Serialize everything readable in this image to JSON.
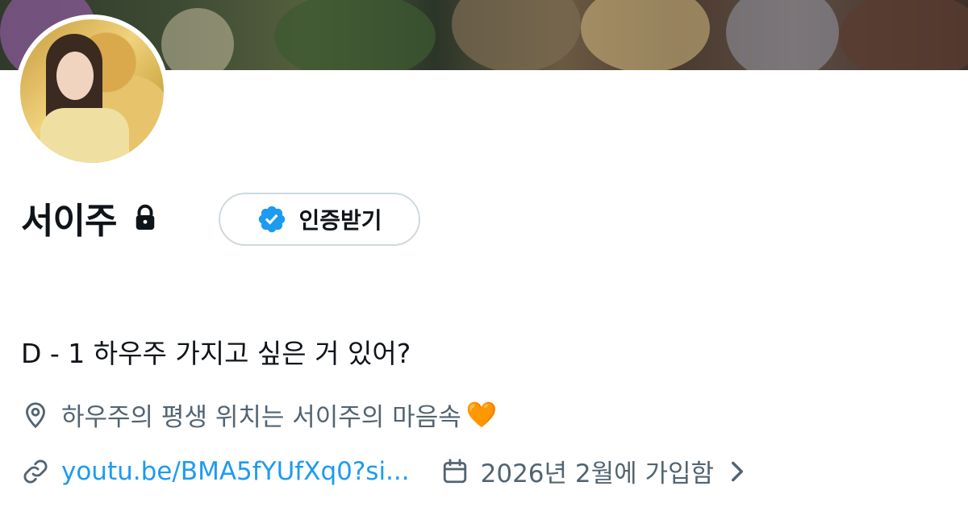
{
  "profile": {
    "name": "서이주",
    "verify_label": "인증받기",
    "bio": "D - 1 하우주 가지고 싶은 거 있어?",
    "location": "하우주의 평생 위치는 서이주의 마음속",
    "location_emoji": "🧡",
    "url": "youtu.be/BMA5fYUfXq0?si...",
    "joined": "2026년 2월에 가입함"
  },
  "icons": {
    "lock": "lock-icon",
    "verified": "verified-badge-icon",
    "location": "location-pin-icon",
    "link": "link-icon",
    "calendar": "calendar-icon",
    "chevron": "chevron-right-icon"
  },
  "colors": {
    "accent": "#1d9bf0",
    "text": "#0f1419",
    "muted": "#536471",
    "heart": "#f4900c"
  }
}
